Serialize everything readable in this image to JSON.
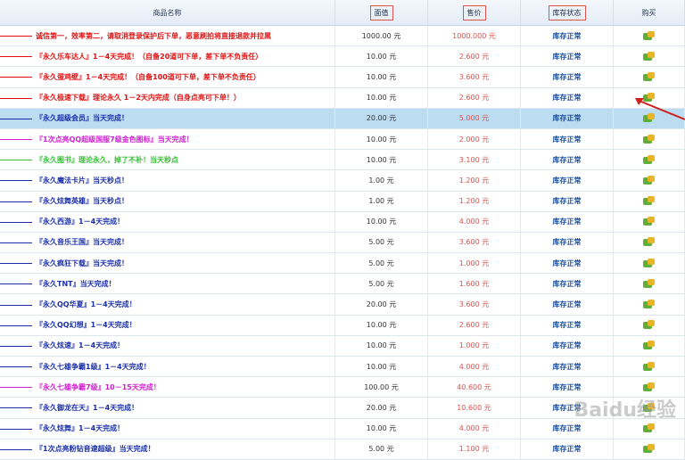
{
  "header": {
    "name": "商品名称",
    "face": "面值",
    "price": "售价",
    "stock": "库存状态",
    "buy": "购买"
  },
  "colors": {
    "red": "#e01010",
    "blue": "#1a2fa8",
    "magenta": "#d020d0",
    "green": "#30c030",
    "selected": "#bcdcf2",
    "price": "#d9534f"
  },
  "rows": [
    {
      "name": "诚信第一，效率第二，请取消登录保护后下单，恶意刷拍将直接退款并拉黑",
      "face": "1000.00 元",
      "price": "1000.000 元",
      "stock": "库存正常",
      "color": "#e01010"
    },
    {
      "name": "『永久乐车达人』1－4天完成！（自备20道可下单，差下单不负责任）",
      "face": "10.00 元",
      "price": "2.600 元",
      "stock": "库存正常",
      "color": "#e01010"
    },
    {
      "name": "『永久蛋鸡壁』1－4天完成！（自备100道可下单，差下单不负责任）",
      "face": "10.00 元",
      "price": "3.600 元",
      "stock": "库存正常",
      "color": "#e01010"
    },
    {
      "name": "『永久极速下载』理论永久 1－2天内完成（自身点亮可下单！）",
      "face": "10.00 元",
      "price": "2.600 元",
      "stock": "库存正常",
      "color": "#e01010"
    },
    {
      "name": "『永久超级会员』当天完成！",
      "face": "20.00 元",
      "price": "5.000 元",
      "stock": "库存正常",
      "color": "#1a2fa8",
      "selected": true
    },
    {
      "name": "『1次点亮QQ超级国服7级金色图标』当天完成！",
      "face": "10.00 元",
      "price": "2.000 元",
      "stock": "库存正常",
      "color": "#d020d0"
    },
    {
      "name": "『永久图书』理论永久，掉了不补！当天秒点",
      "face": "10.00 元",
      "price": "3.100 元",
      "stock": "库存正常",
      "color": "#30c030"
    },
    {
      "name": "『永久魔法卡片』当天秒点！",
      "face": "1.00 元",
      "price": "1.200 元",
      "stock": "库存正常",
      "color": "#1a2fa8"
    },
    {
      "name": "『永久炫舞英雄』当天秒点！",
      "face": "1.00 元",
      "price": "1.200 元",
      "stock": "库存正常",
      "color": "#1a2fa8"
    },
    {
      "name": "『永久西游』1－4天完成！",
      "face": "10.00 元",
      "price": "4.000 元",
      "stock": "库存正常",
      "color": "#1a2fa8"
    },
    {
      "name": "『永久音乐王国』当天完成！",
      "face": "5.00 元",
      "price": "3.600 元",
      "stock": "库存正常",
      "color": "#1a2fa8"
    },
    {
      "name": "『永久疯狂下载』当天完成！",
      "face": "5.00 元",
      "price": "1.000 元",
      "stock": "库存正常",
      "color": "#1a2fa8"
    },
    {
      "name": "『永久TNT』当天完成！",
      "face": "5.00 元",
      "price": "1.600 元",
      "stock": "库存正常",
      "color": "#1a2fa8"
    },
    {
      "name": "『永久QQ华夏』1－4天完成！",
      "face": "20.00 元",
      "price": "3.600 元",
      "stock": "库存正常",
      "color": "#1a2fa8"
    },
    {
      "name": "『永久QQ幻想』1－4天完成！",
      "face": "10.00 元",
      "price": "2.600 元",
      "stock": "库存正常",
      "color": "#1a2fa8"
    },
    {
      "name": "『永久炫速』1－4天完成！",
      "face": "10.00 元",
      "price": "1.000 元",
      "stock": "库存正常",
      "color": "#1a2fa8"
    },
    {
      "name": "『永久七雄争霸1级』1－4天完成！",
      "face": "10.00 元",
      "price": "4.000 元",
      "stock": "库存正常",
      "color": "#1a2fa8"
    },
    {
      "name": "『永久七雄争霸7级』10－15天完成！",
      "face": "100.00 元",
      "price": "40.600 元",
      "stock": "库存正常",
      "color": "#d020d0"
    },
    {
      "name": "『永久御龙在天』1－4天完成！",
      "face": "20.00 元",
      "price": "10.600 元",
      "stock": "库存正常",
      "color": "#1a2fa8"
    },
    {
      "name": "『永久炫舞』1－4天完成！",
      "face": "10.00 元",
      "price": "4.000 元",
      "stock": "库存正常",
      "color": "#1a2fa8"
    },
    {
      "name": "『1次点亮粉钻音速超级』当天完成！",
      "face": "5.00 元",
      "price": "1.100 元",
      "stock": "库存正常",
      "color": "#1a2fa8"
    }
  ],
  "watermark": "Baidu经验"
}
